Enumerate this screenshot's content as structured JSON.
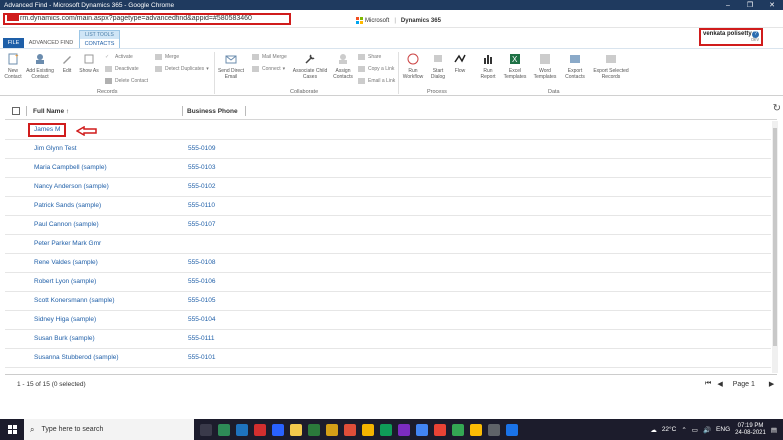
{
  "window": {
    "title": "Advanced Find - Microsoft Dynamics 365 - Google Chrome"
  },
  "address": {
    "url": "rm.dynamics.com/main.aspx?pagetype=advancedfind&appid=#580583460"
  },
  "brand": {
    "company": "Microsoft",
    "product": "Dynamics 365"
  },
  "user": {
    "name": "venkata polisetty",
    "org": "dev",
    "help": "?"
  },
  "tabs": {
    "file": "FILE",
    "advanced_find": "ADVANCED FIND",
    "group_title": "LIST TOOLS",
    "contacts": "CONTACTS"
  },
  "ribbon": {
    "new_contact": "New Contact",
    "add_existing": "Add Existing Contact",
    "edit": "Edit",
    "show_as": "Show As",
    "activate": "Activate",
    "deactivate": "Deactivate",
    "delete_contact": "Delete Contact",
    "merge": "Merge",
    "detect_duplicates": "Detect Duplicates",
    "send_direct_email": "Send Direct Email",
    "mail_merge": "Mail Merge",
    "connect": "Connect",
    "associate_child": "Associate Child Cases",
    "assign_contacts": "Assign Contacts",
    "share": "Share",
    "copy_link": "Copy a Link",
    "email_link": "Email a Link",
    "run_workflow": "Run Workflow",
    "start_dialog": "Start Dialog",
    "flow": "Flow",
    "run_report": "Run Report",
    "excel_templates": "Excel Templates",
    "word_templates": "Word Templates",
    "export_contacts": "Export Contacts",
    "export_selected": "Export Selected Records",
    "groups": {
      "records": "Records",
      "collaborate": "Collaborate",
      "process": "Process",
      "data": "Data"
    }
  },
  "grid": {
    "columns": {
      "full_name": "Full Name ↑",
      "business_phone": "Business Phone"
    },
    "rows": [
      {
        "name": "James M",
        "phone": ""
      },
      {
        "name": "Jim Glynn Test",
        "phone": "555-0109"
      },
      {
        "name": "Maria Campbell (sample)",
        "phone": "555-0103"
      },
      {
        "name": "Nancy Anderson (sample)",
        "phone": "555-0102"
      },
      {
        "name": "Patrick Sands (sample)",
        "phone": "555-0110"
      },
      {
        "name": "Paul Cannon (sample)",
        "phone": "555-0107"
      },
      {
        "name": "Peter Parker Mark Gmr",
        "phone": ""
      },
      {
        "name": "Rene Valdes (sample)",
        "phone": "555-0108"
      },
      {
        "name": "Robert Lyon (sample)",
        "phone": "555-0106"
      },
      {
        "name": "Scott Konersmann (sample)",
        "phone": "555-0105"
      },
      {
        "name": "Sidney Higa (sample)",
        "phone": "555-0104"
      },
      {
        "name": "Susan Burk (sample)",
        "phone": "555-0111"
      },
      {
        "name": "Susanna Stubberod (sample)",
        "phone": "555-0101"
      }
    ],
    "footer_count": "1 - 15 of 15 (0 selected)",
    "page_label": "Page 1"
  },
  "taskbar": {
    "search_placeholder": "Type here to search",
    "weather": "22°C",
    "lang": "ENG",
    "time": "07:19 PM",
    "date": "24-08-2021"
  },
  "colors": {
    "accent": "#1e5fa8",
    "highlight": "#d01c1c",
    "link": "#1f5fa8"
  }
}
